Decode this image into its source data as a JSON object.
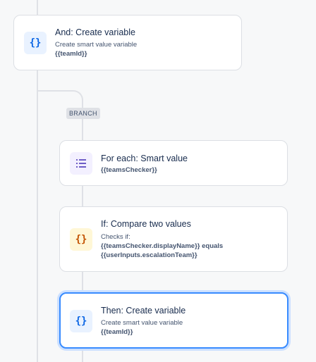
{
  "flow": {
    "branch_label": "BRANCH",
    "cards": {
      "create_var_top": {
        "title": "And: Create variable",
        "subtitle": "Create smart value variable",
        "value": "{{teamId}}",
        "icon": "curly-braces-icon"
      },
      "for_each": {
        "title": "For each: Smart value",
        "value": "{{teamsChecker}}",
        "icon": "list-icon"
      },
      "if_compare": {
        "title": "If: Compare two values",
        "subtitle": "Checks if:",
        "value_line1_code": "{{teamsChecker.displayName}}",
        "value_line1_op": "equals",
        "value_line2": "{{userInputs.escalationTeam}}",
        "icon": "curly-braces-icon"
      },
      "then_create": {
        "title": "Then: Create variable",
        "subtitle": "Create smart value variable",
        "value": "{{teamId}}",
        "icon": "curly-braces-icon"
      }
    },
    "colors": {
      "accent_selected": "#388bff",
      "icon_blue": "#0c66e4",
      "icon_purple": "#6e5dc6",
      "icon_orange": "#c25100"
    }
  }
}
